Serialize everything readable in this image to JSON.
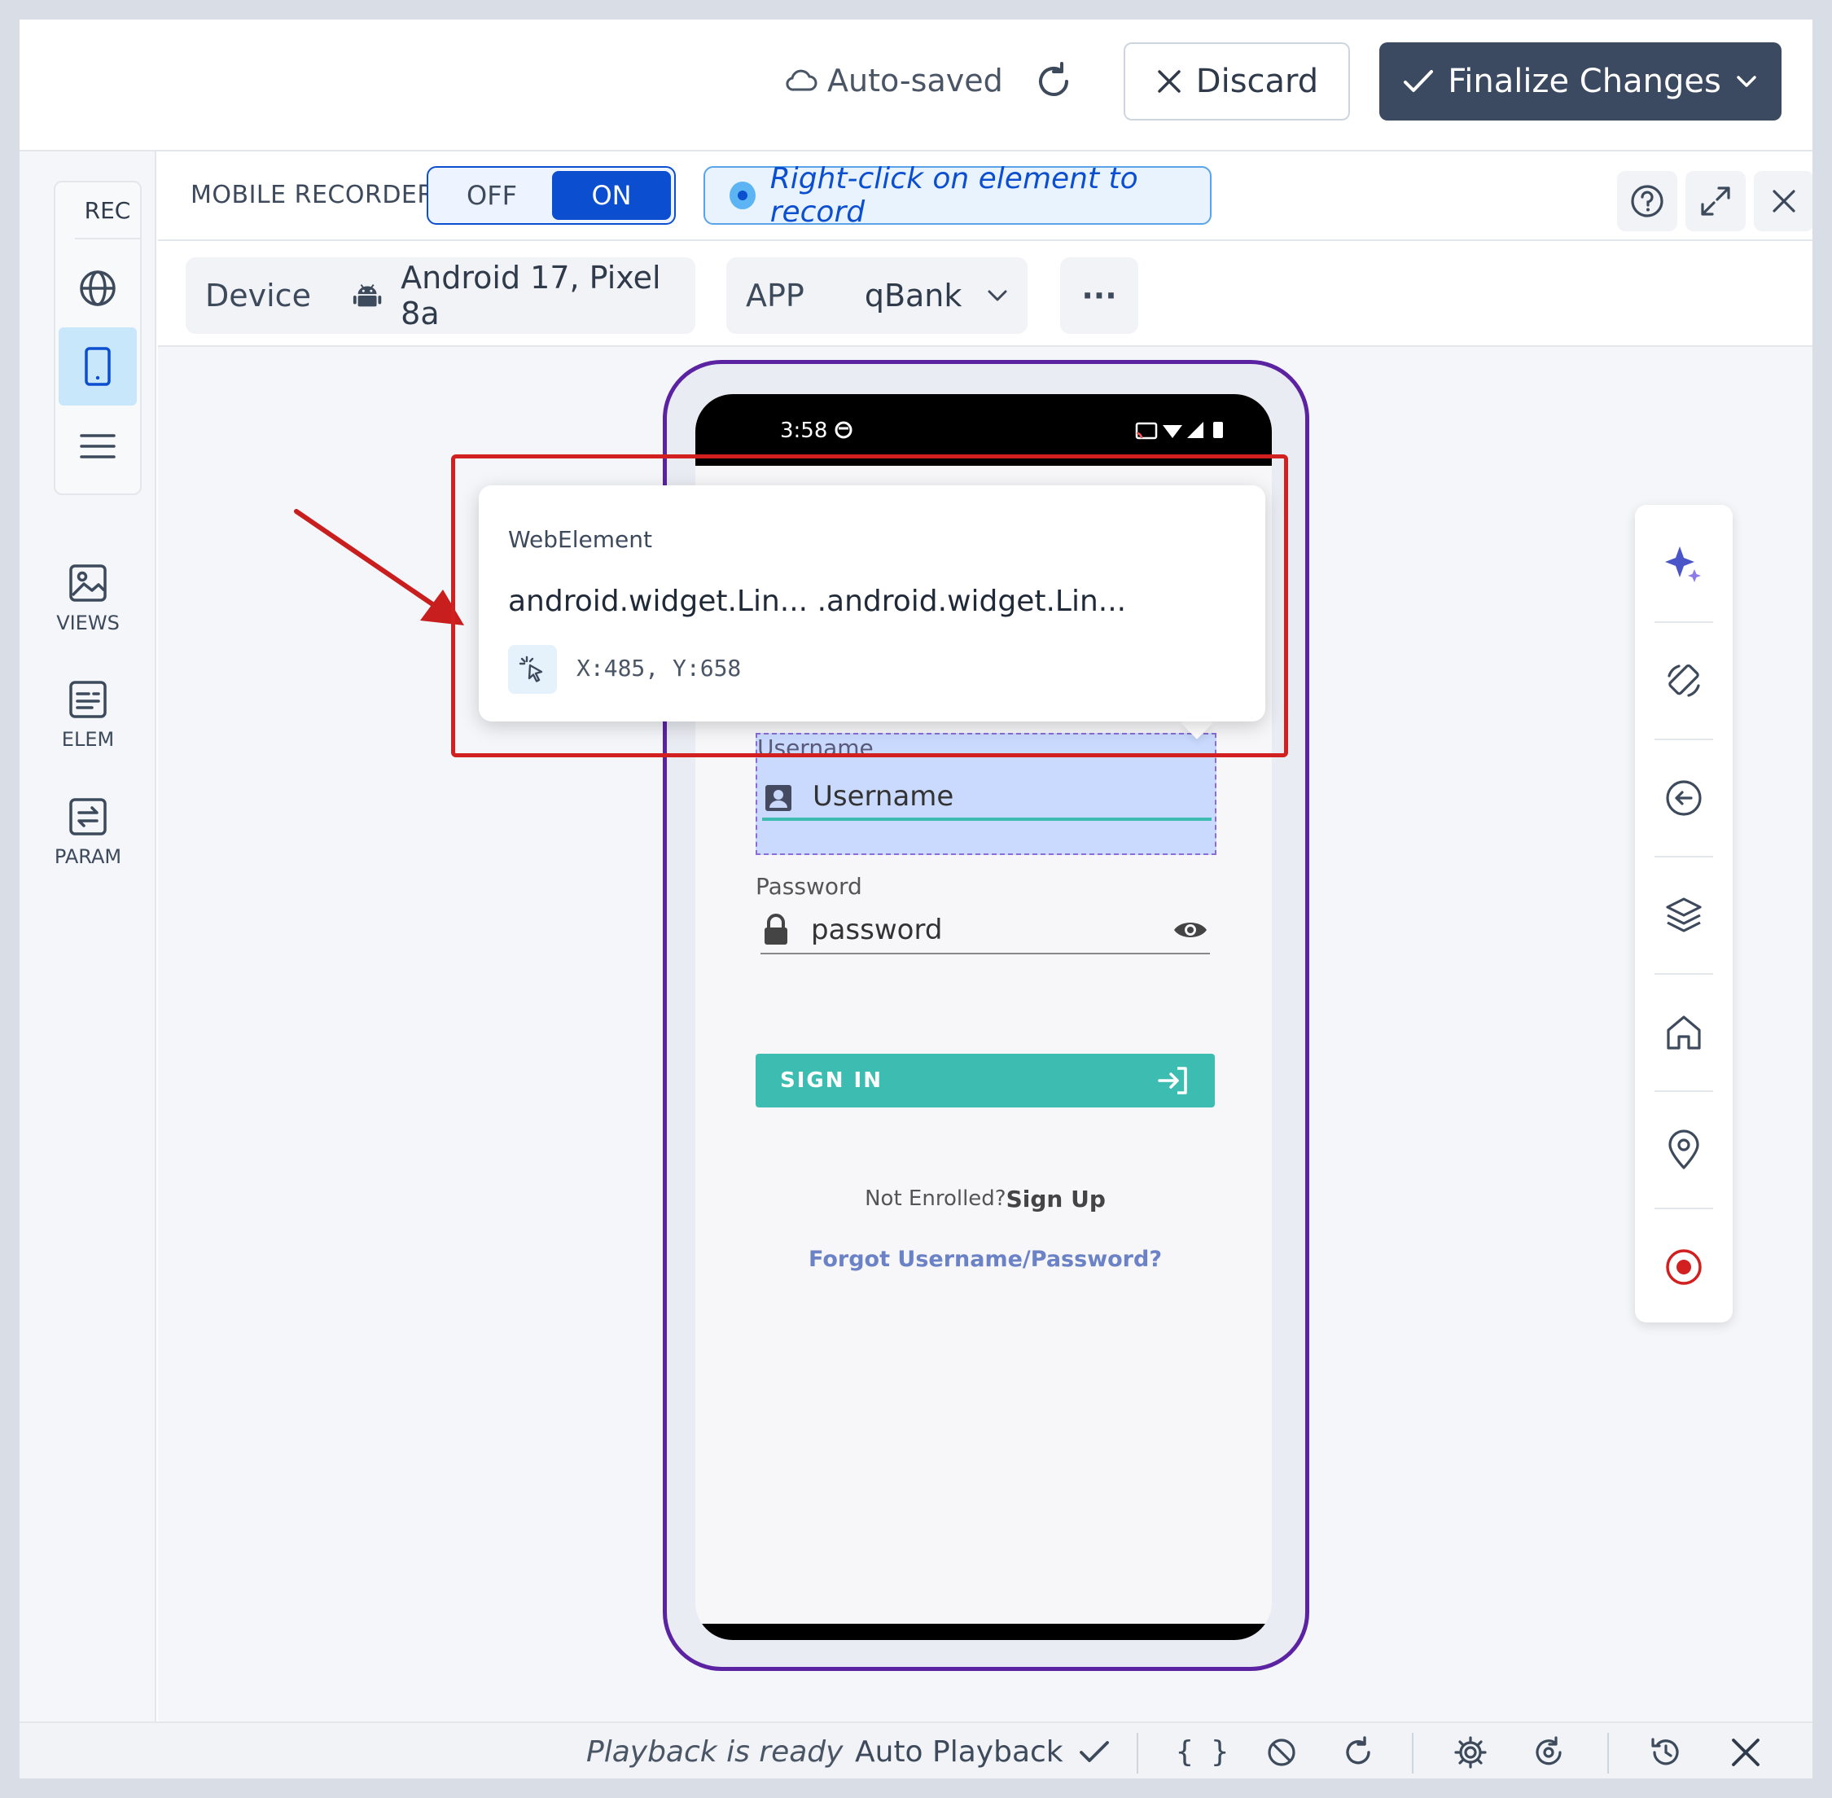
{
  "header": {
    "autosave_label": "Auto-saved",
    "discard_label": "Discard",
    "finalize_label": "Finalize Changes"
  },
  "rail": {
    "rec_label": "REC",
    "tools": [
      {
        "label": "VIEWS"
      },
      {
        "label": "ELEM"
      },
      {
        "label": "PARAM"
      }
    ]
  },
  "recorder": {
    "label": "MOBILE RECORDER",
    "toggle_off": "OFF",
    "toggle_on": "ON",
    "hint": "Right-click on element to record"
  },
  "device_bar": {
    "device_label": "Device",
    "device_value": "Android 17, Pixel 8a",
    "app_label": "APP",
    "app_value": "qBank",
    "more_label": "···"
  },
  "phone": {
    "time": "3:58",
    "username_label": "Username",
    "username_placeholder": "Username",
    "password_label": "Password",
    "password_placeholder": "password",
    "signin_label": "SIGN IN",
    "not_enrolled": "Not Enrolled?",
    "sign_up": "Sign Up",
    "forgot": "Forgot Username/Password?"
  },
  "popup": {
    "title": "WebElement",
    "path": "android.widget.Lin... .android.widget.Lin...",
    "coords": "X:485, Y:658"
  },
  "bottom": {
    "status": "Playback is ready",
    "auto_playback": "Auto Playback",
    "braces": "{ }"
  },
  "colors": {
    "accent_blue": "#0b4fd0",
    "finalize_bg": "#3b4a60",
    "phone_frame": "#5b23a1",
    "signin_teal": "#3dbdb1",
    "highlight_red": "#d21f1f",
    "record_red": "#d21f1f",
    "sparkle_purple": "#5b5bd6"
  }
}
